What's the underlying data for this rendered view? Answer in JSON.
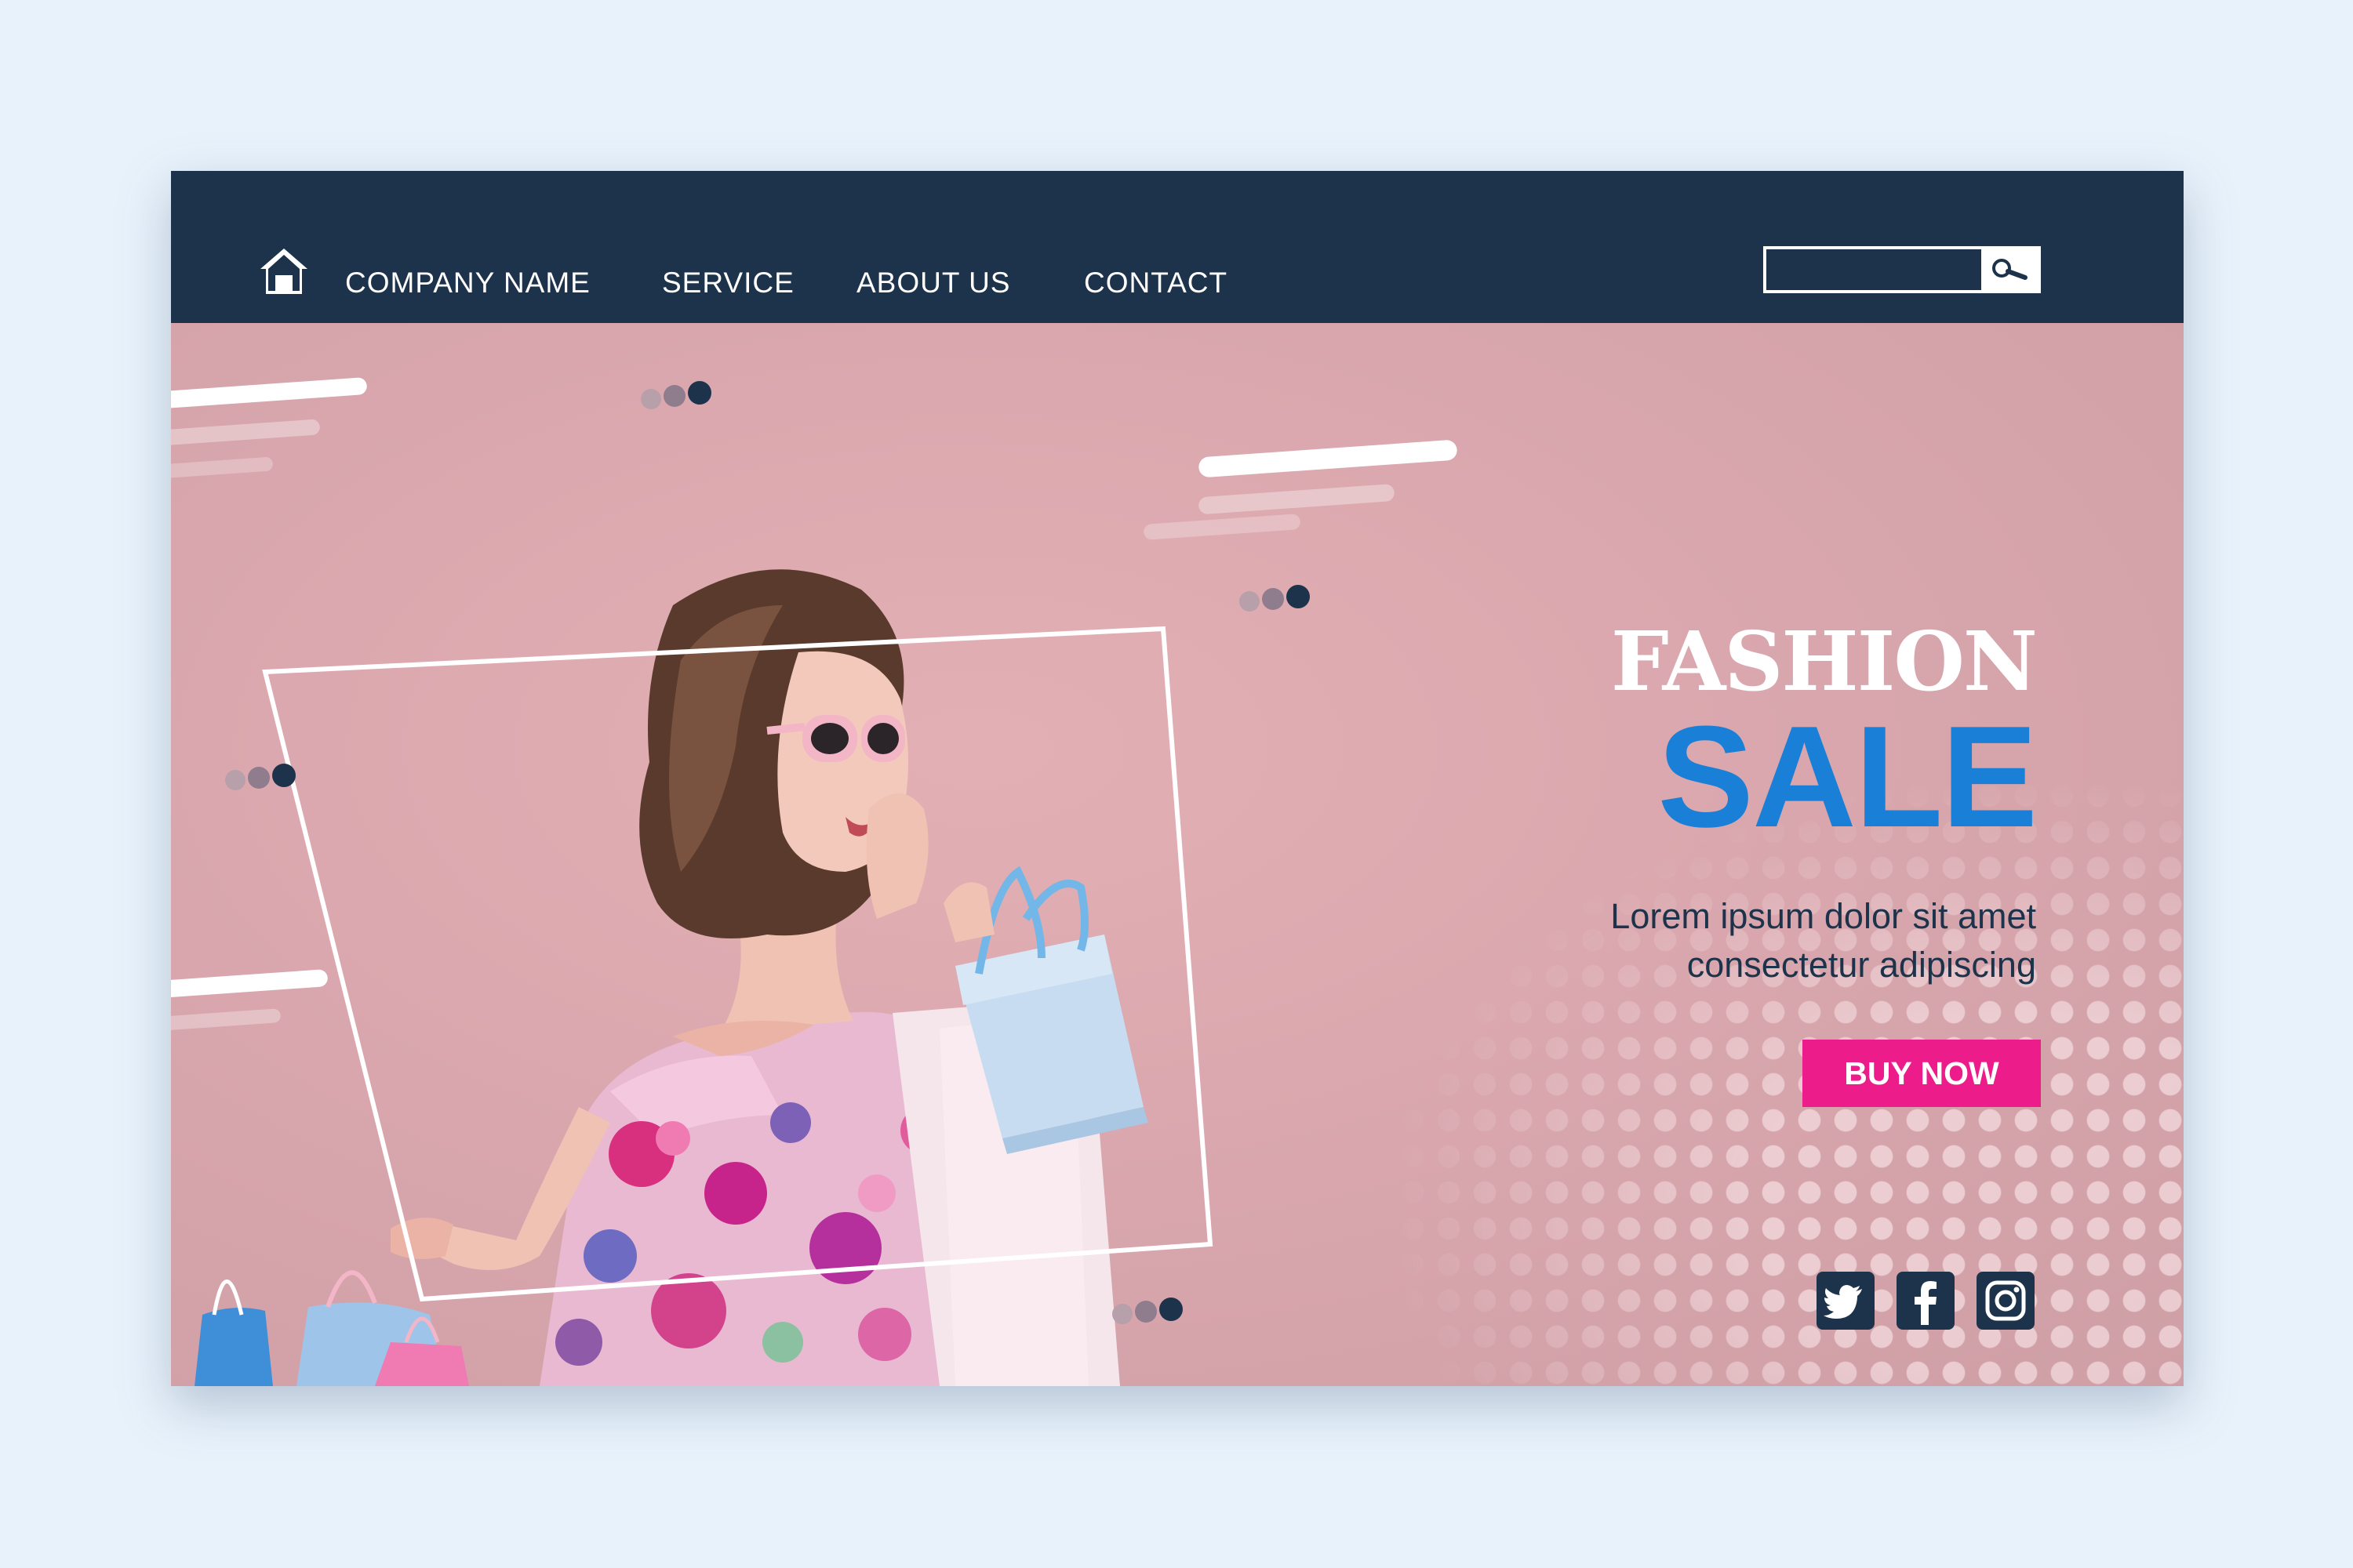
{
  "nav": {
    "links": [
      "COMPANY NAME",
      "SERVICE",
      "ABOUT US",
      "CONTACT"
    ],
    "search_placeholder": ""
  },
  "hero": {
    "headline_top": "FASHION",
    "headline_main": "SALE",
    "subtext_line1": "Lorem ipsum dolor sit amet",
    "subtext_line2": "consectetur adipiscing",
    "cta_label": "BUY NOW"
  },
  "social": [
    "twitter-icon",
    "facebook-icon",
    "instagram-icon"
  ],
  "colors": {
    "navbar": "#1c334b",
    "hero_bg": "#d9a7ad",
    "accent_blue": "#1a7fd6",
    "cta_pink": "#ec1c8b",
    "text_dark": "#1c334b"
  },
  "icons": {
    "home": "home-icon",
    "search": "search-icon"
  }
}
